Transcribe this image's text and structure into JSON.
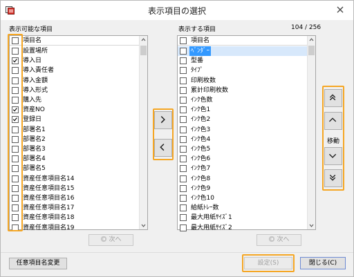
{
  "window": {
    "title": "表示項目の選択"
  },
  "left": {
    "label": "表示可能な項目",
    "header": "項目名",
    "next_label": "次へ",
    "items": [
      {
        "label": "設置場所",
        "checked": false
      },
      {
        "label": "導入日",
        "checked": true
      },
      {
        "label": "導入責任者",
        "checked": false
      },
      {
        "label": "導入金額",
        "checked": false
      },
      {
        "label": "導入形式",
        "checked": false
      },
      {
        "label": "購入先",
        "checked": false
      },
      {
        "label": "資産NO",
        "checked": true
      },
      {
        "label": "登録日",
        "checked": true
      },
      {
        "label": "部署名1",
        "checked": false
      },
      {
        "label": "部署名2",
        "checked": false
      },
      {
        "label": "部署名3",
        "checked": false
      },
      {
        "label": "部署名4",
        "checked": false
      },
      {
        "label": "部署名5",
        "checked": false
      },
      {
        "label": "資産任意項目名14",
        "checked": false
      },
      {
        "label": "資産任意項目名15",
        "checked": false
      },
      {
        "label": "資産任意項目名16",
        "checked": false
      },
      {
        "label": "資産任意項目名17",
        "checked": false
      },
      {
        "label": "資産任意項目名18",
        "checked": false
      },
      {
        "label": "資産任意項目名19",
        "checked": false
      }
    ]
  },
  "right": {
    "label": "表示する項目",
    "count": "104 / 256",
    "header": "項目名",
    "next_label": "次へ",
    "items": [
      {
        "label": "ﾍﾞﾝﾀﾞｰ",
        "checked": false,
        "selected": true
      },
      {
        "label": "型番",
        "checked": false
      },
      {
        "label": "ﾀｲﾌﾟ",
        "checked": false
      },
      {
        "label": "印刷枚数",
        "checked": false
      },
      {
        "label": "累計印刷枚数",
        "checked": false
      },
      {
        "label": "ｲﾝｸ色数",
        "checked": false
      },
      {
        "label": "ｲﾝｸ色1",
        "checked": false
      },
      {
        "label": "ｲﾝｸ色2",
        "checked": false
      },
      {
        "label": "ｲﾝｸ色3",
        "checked": false
      },
      {
        "label": "ｲﾝｸ色4",
        "checked": false
      },
      {
        "label": "ｲﾝｸ色5",
        "checked": false
      },
      {
        "label": "ｲﾝｸ色6",
        "checked": false
      },
      {
        "label": "ｲﾝｸ色7",
        "checked": false
      },
      {
        "label": "ｲﾝｸ色8",
        "checked": false
      },
      {
        "label": "ｲﾝｸ色9",
        "checked": false
      },
      {
        "label": "ｲﾝｸ色10",
        "checked": false
      },
      {
        "label": "給紙ﾄﾚｰ数",
        "checked": false
      },
      {
        "label": "最大用紙ｻｲｽﾞ1",
        "checked": false
      },
      {
        "label": "最大用紙ｻｲｽﾞ2",
        "checked": false
      }
    ]
  },
  "move": {
    "label": "移動"
  },
  "footer": {
    "rename_label": "任意項目名変更",
    "ok_label": "設定(S)",
    "close_label": "閉じる(C)"
  },
  "colors": {
    "highlight": "#f5a623",
    "selection": "#3399ff"
  }
}
